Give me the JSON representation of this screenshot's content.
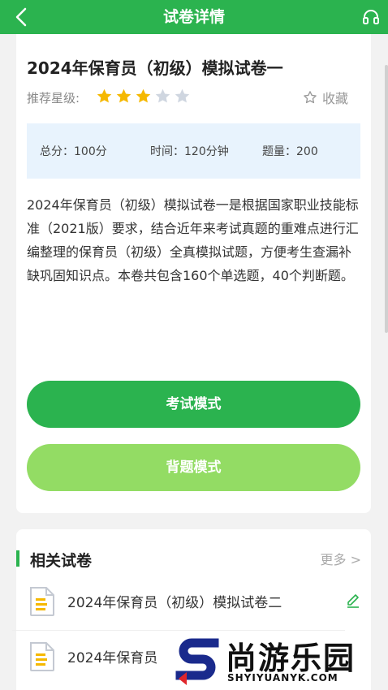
{
  "header": {
    "title": "试卷详情",
    "back_icon": "chevron-left-icon",
    "audio_icon": "headset-icon"
  },
  "exam": {
    "title": "2024年保育员（初级）模拟试卷一",
    "rating_label": "推荐星级:",
    "rating": 3,
    "rating_max": 5,
    "favorite_label": "收藏",
    "stats": {
      "score": "总分：100分",
      "time": "时间：120分钟",
      "count": "题量：200"
    },
    "description": "2024年保育员（初级）模拟试卷一是根据国家职业技能标准（2021版）要求，结合近年来考试真题的重难点进行汇编整理的保育员（初级）全真模拟试题，方便考生查漏补缺巩固知识点。本卷共包含160个单选题，40个判断题。",
    "btn_exam": "考试模式",
    "btn_study": "背题模式"
  },
  "related": {
    "title": "相关试卷",
    "more": "更多 >",
    "items": [
      {
        "name": "2024年保育员（初级）模拟试卷二"
      },
      {
        "name": "2024年保育员"
      }
    ]
  },
  "watermark": {
    "text": "尚游乐园",
    "url": "SHYIYUANYK.COM"
  },
  "colors": {
    "primary": "#2bb34f",
    "secondary_button": "#93dc64",
    "star_on": "#f5b800",
    "star_off": "#cfd6e0",
    "info_bg": "#e8f3fd"
  }
}
